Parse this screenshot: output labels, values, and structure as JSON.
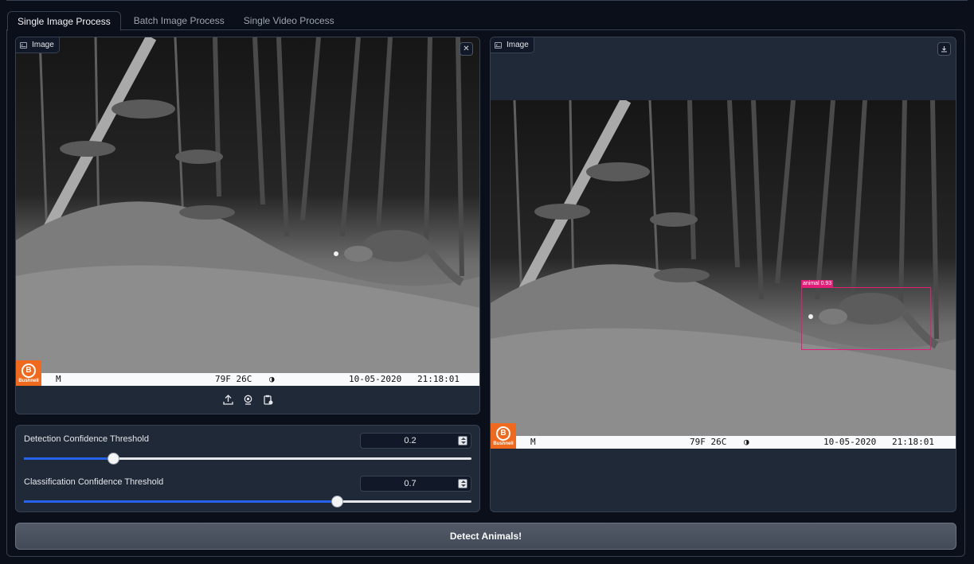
{
  "tabs": [
    {
      "label": "Single Image Process",
      "active": true
    },
    {
      "label": "Batch Image Process",
      "active": false
    },
    {
      "label": "Single Video Process",
      "active": false
    }
  ],
  "input_panel": {
    "badge_label": "Image",
    "badge_icon": "image-icon",
    "close_icon": "close-icon",
    "toolbar_icons": [
      "upload-icon",
      "webcam-icon",
      "clipboard-icon"
    ]
  },
  "output_panel": {
    "badge_label": "Image",
    "badge_icon": "image-icon",
    "download_icon": "download-icon",
    "detection_label": "animal  0.93",
    "detection_color": "#e11d77"
  },
  "camera_stamp": {
    "brand": "Bushnell",
    "brand_mark": "B",
    "mode_glyph": "M",
    "temperature": "79F 26C",
    "moon_glyph": "◑",
    "date": "10-05-2020",
    "time": "21:18:01",
    "brand_color": "#ef6a1f"
  },
  "sliders": [
    {
      "label": "Detection Confidence Threshold",
      "value": "0.2",
      "fraction": 0.2
    },
    {
      "label": "Classification Confidence Threshold",
      "value": "0.7",
      "fraction": 0.7
    }
  ],
  "detect_button": {
    "label": "Detect Animals!"
  },
  "colors": {
    "background": "#0b0f19",
    "panel": "#1f2937",
    "accent": "#2563eb"
  }
}
